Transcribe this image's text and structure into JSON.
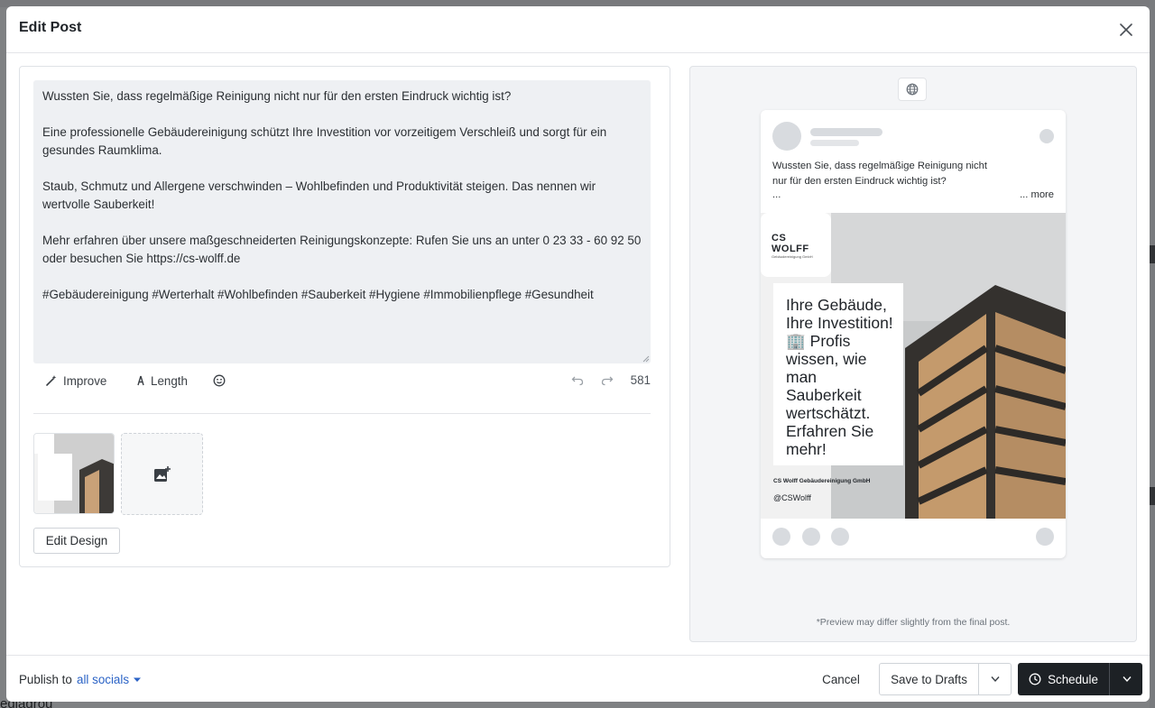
{
  "modal": {
    "title": "Edit Post"
  },
  "post": {
    "text": "Wussten Sie, dass regelmäßige Reinigung nicht nur für den ersten Eindruck wichtig ist?\n\nEine professionelle Gebäudereinigung schützt Ihre Investition vor vorzeitigem Verschleiß und sorgt für ein gesundes Raumklima.\n\nStaub, Schmutz und Allergene verschwinden – Wohlbefinden und Produktivität steigen. Das nennen wir wertvolle Sauberkeit!\n\nMehr erfahren über unsere maßgeschneiderten Reinigungskonzepte: Rufen Sie uns an unter 0 23 33 - 60 92 50 oder besuchen Sie https://cs-wolff.de\n\n#Gebäudereinigung #Werterhalt #Wohlbefinden #Sauberkeit #Hygiene #Immobilienpflege #Gesundheit",
    "char_count": "581"
  },
  "toolbar": {
    "improve_label": "Improve",
    "length_label": "Length"
  },
  "media": {
    "edit_design_label": "Edit Design"
  },
  "preview": {
    "caption_line1": "Wussten Sie, dass regelmäßige Reinigung nicht",
    "caption_line2": "nur für den ersten Eindruck wichtig ist?",
    "caption_ellipsis": "...",
    "more_label": "... more",
    "image": {
      "logo_text": "CS WOLFF",
      "logo_sub": "Gebäudereinigung GmbH",
      "headline": [
        "Ihre Gebäude,",
        "Ihre Investition!",
        "🏢 Profis",
        "wissen, wie",
        "man",
        "Sauberkeit",
        "wertschätzt.",
        "Erfahren Sie",
        "mehr!"
      ],
      "company": "CS Wolff Gebäudereinigung GmbH",
      "handle": "@CSWolff"
    },
    "note": "*Preview may differ slightly from the final post."
  },
  "footer": {
    "publish_label": "Publish to",
    "socials_value": "all socials",
    "cancel_label": "Cancel",
    "drafts_label": "Save to Drafts",
    "schedule_label": "Schedule"
  },
  "background": {
    "bottom_text": "ediagrou"
  },
  "colors": {
    "accent": "#2b63c6",
    "primary_button": "#1d2125"
  },
  "icons": [
    "close-icon",
    "magic-wand-icon",
    "length-icon",
    "emoji-icon",
    "undo-icon",
    "redo-icon",
    "add-image-icon",
    "globe-icon",
    "chevron-down-icon",
    "clock-icon"
  ]
}
